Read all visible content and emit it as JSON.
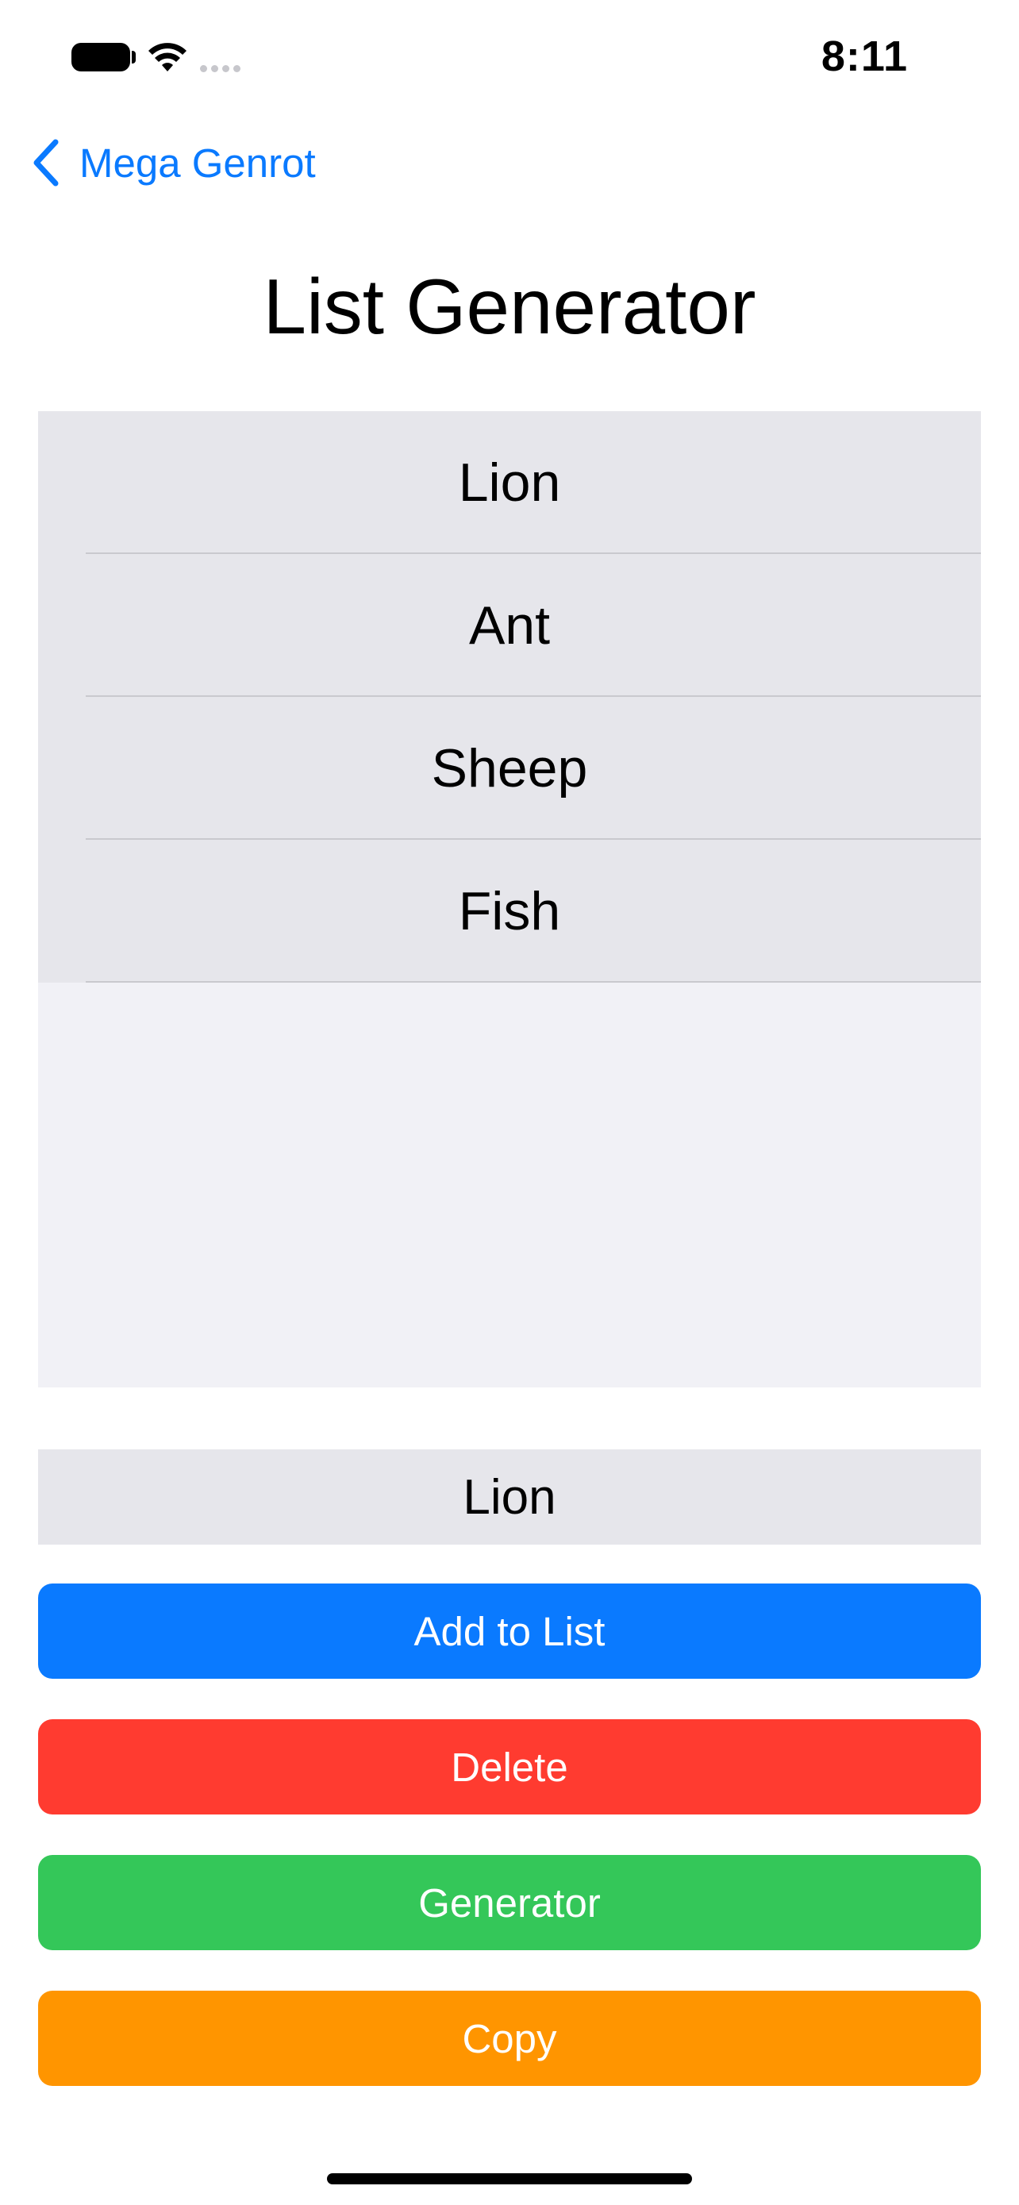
{
  "status_bar": {
    "time": "8:11",
    "icons": [
      "battery-icon",
      "wifi-icon",
      "signal-icon"
    ]
  },
  "nav": {
    "back_label": "Mega Genrot",
    "accent_color": "#0a7aff"
  },
  "page": {
    "title": "List Generator"
  },
  "list": {
    "items": [
      "Lion",
      "Ant",
      "Sheep",
      "Fish"
    ]
  },
  "input": {
    "value": "Lion"
  },
  "buttons": {
    "add": {
      "label": "Add to List",
      "color": "#0a7aff"
    },
    "delete": {
      "label": "Delete",
      "color": "#ff3b30"
    },
    "generator": {
      "label": "Generator",
      "color": "#34c759"
    },
    "copy": {
      "label": "Copy",
      "color": "#ff9500"
    }
  }
}
